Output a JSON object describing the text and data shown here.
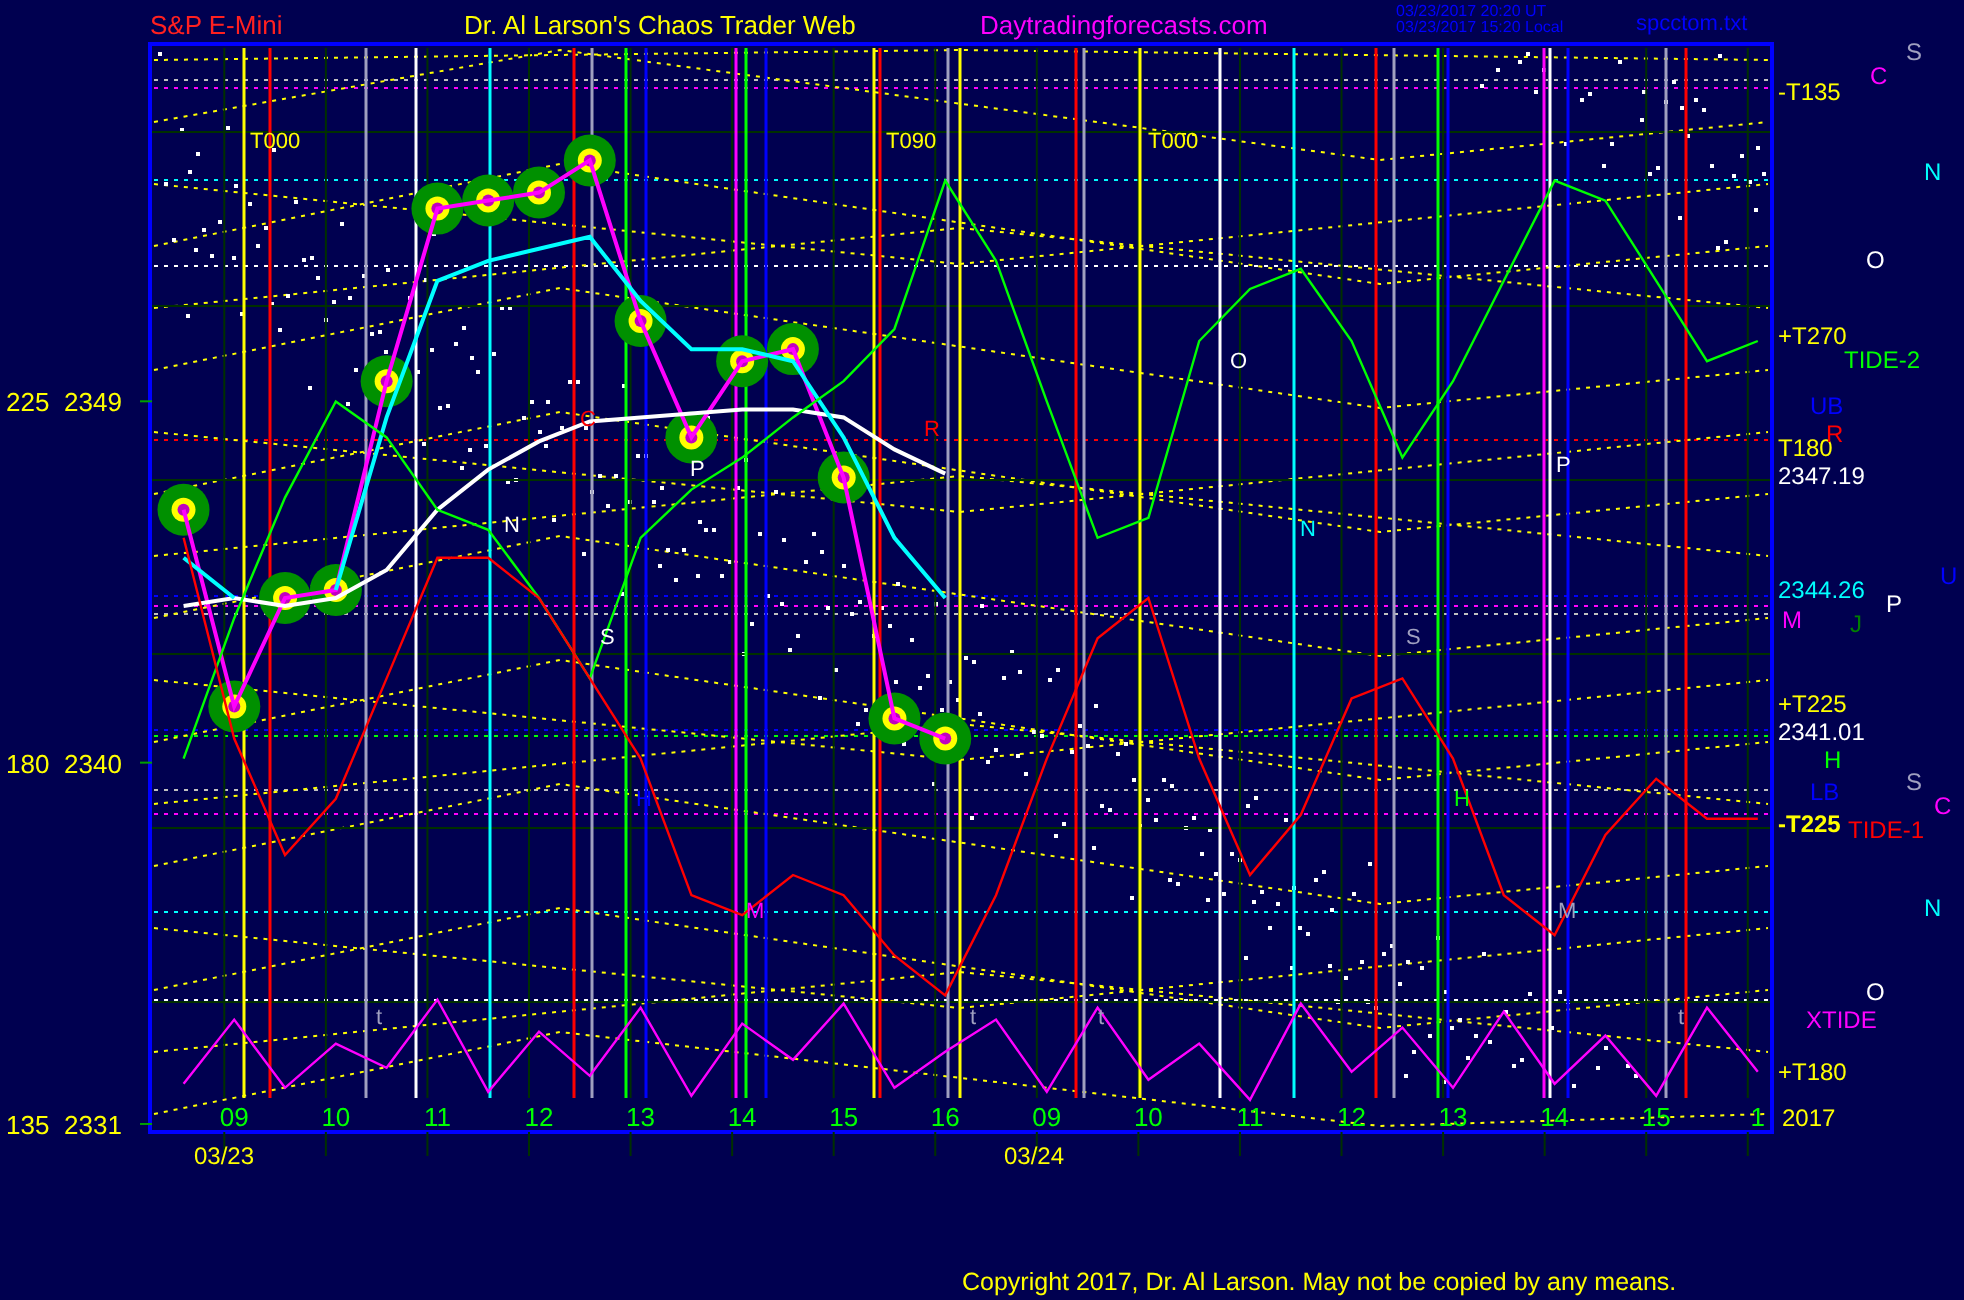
{
  "header": {
    "instrument": "S&P E-Mini",
    "title": "Dr. Al Larson's Chaos Trader Web",
    "site": "Daytradingforecasts.com",
    "timestamps": [
      "03/23/2017 20:20 UT",
      "03/23/2017 15:20 Local"
    ],
    "file": "spcctom.txt"
  },
  "angle_labels": [
    "225",
    "180",
    "135"
  ],
  "dates": [
    "03/23",
    "03/24"
  ],
  "chart": {
    "chart_data": {
      "type": "line",
      "categories": [
        null,
        "09",
        null,
        "10",
        null,
        "11",
        null,
        "12",
        null,
        "13",
        null,
        "14",
        null,
        "15",
        null,
        "16",
        null,
        "09",
        null,
        "10",
        null,
        "11",
        null,
        "12",
        null,
        "13",
        null,
        "14",
        null,
        "15",
        null,
        "1"
      ],
      "grid": true,
      "series": [
        {
          "color": "#ff00ff",
          "marker": "o",
          "values": [
            2346.3,
            2341.4,
            2344.1,
            2344.3,
            2349.5,
            2353.8,
            2354.0,
            2354.2,
            2355.0,
            2351.0,
            2348.1,
            2350.0,
            2350.3,
            2347.1,
            2341.1,
            2340.6,
            null,
            null,
            null,
            null,
            null,
            null,
            null,
            null,
            null,
            null,
            null,
            null,
            null,
            null,
            null,
            null
          ]
        },
        {
          "color": "#ffffff",
          "values": [
            2343.9,
            2344.1,
            2343.9,
            2344.1,
            2344.8,
            2346.3,
            2347.3,
            2348.0,
            2348.5,
            2348.6,
            2348.7,
            2348.8,
            2348.8,
            2348.6,
            2347.8,
            2347.2,
            null,
            null,
            null,
            null,
            null,
            null,
            null,
            null,
            null,
            null,
            null,
            null,
            null,
            null,
            null,
            null
          ]
        },
        {
          "color": "#00ffff",
          "values": [
            2345.1,
            2344.1,
            null,
            2344.3,
            2348.6,
            2352.0,
            2352.5,
            2352.8,
            2353.1,
            2351.5,
            2350.3,
            2350.3,
            2350.0,
            2348.1,
            2345.6,
            2344.1,
            null,
            null,
            null,
            null,
            null,
            null,
            null,
            null,
            null,
            null,
            null,
            null,
            null,
            null,
            null,
            null
          ]
        },
        {
          "name": "TIDE-2",
          "color": "#00ff00",
          "values": [
            2340.1,
            2343.6,
            2346.6,
            2349.0,
            2348.1,
            2346.3,
            2345.8,
            2344.1,
            2342.1,
            2345.6,
            2346.8,
            2347.6,
            2348.6,
            2349.5,
            2350.8,
            2354.5,
            2352.5,
            2349.0,
            2345.6,
            2346.1,
            2350.5,
            2351.8,
            2352.3,
            2350.5,
            2347.6,
            2349.5,
            2352.0,
            2354.5,
            2354.0,
            2352.0,
            2350.0,
            2350.5
          ]
        },
        {
          "name": "TIDE-1",
          "color": "#ff0000",
          "values": [
            2345.6,
            2340.6,
            2337.7,
            2339.1,
            2342.1,
            2345.1,
            2345.1,
            2344.1,
            2342.1,
            2340.1,
            2336.7,
            2336.2,
            2337.2,
            2336.7,
            2335.2,
            2334.2,
            2336.7,
            2340.1,
            2343.1,
            2344.1,
            2340.1,
            2337.2,
            2338.7,
            2341.6,
            2342.1,
            2340.1,
            2336.7,
            2335.7,
            2338.2,
            2339.6,
            2338.6,
            2338.6
          ]
        },
        {
          "name": "XTIDE",
          "color": "#ff00ff",
          "values": [
            2332.0,
            2333.6,
            2331.9,
            2333.0,
            2332.4,
            2334.1,
            2331.8,
            2333.3,
            2332.2,
            2333.9,
            2331.7,
            2333.5,
            2332.6,
            2334.0,
            2331.9,
            2332.8,
            2333.6,
            2331.8,
            2333.9,
            2332.1,
            2333.0,
            2331.6,
            2334.0,
            2332.3,
            2333.4,
            2331.9,
            2333.8,
            2332.0,
            2333.2,
            2331.7,
            2333.9,
            2332.3
          ]
        }
      ],
      "ylim": [
        2330.8,
        2357.9
      ],
      "yticks": [
        2331,
        2340,
        2349
      ]
    }
  },
  "top_labels": [
    "T000",
    "T090",
    "T000"
  ],
  "right_labels": [
    {
      "text": "-T135",
      "color": "#ffff00"
    },
    {
      "text": "+T270",
      "color": "#ffff00"
    },
    {
      "text": "T180",
      "color": "#ffff00"
    },
    {
      "text": "2347.19",
      "color": "#ffffff"
    },
    {
      "text": "2344.26",
      "color": "#00ffff"
    },
    {
      "text": "+T225",
      "color": "#ffff00"
    },
    {
      "text": "2341.01",
      "color": "#ffffff"
    },
    {
      "text": "-T225",
      "color": "#ffff00"
    },
    {
      "text": "+T180",
      "color": "#ffff00"
    },
    {
      "text": "2017",
      "color": "#ffff00"
    }
  ],
  "side_letters": [
    {
      "text": "S",
      "color": "#a0a0c0"
    },
    {
      "text": "C",
      "color": "#ff00ff"
    },
    {
      "text": "N",
      "color": "#00ffff"
    },
    {
      "text": "O",
      "color": "#ffffff"
    },
    {
      "text": "UB",
      "color": "#0000ff"
    },
    {
      "text": "R",
      "color": "#ff0000"
    },
    {
      "text": "U",
      "color": "#0000ff"
    },
    {
      "text": "M",
      "color": "#ff00ff"
    },
    {
      "text": "J",
      "color": "#008000"
    },
    {
      "text": "P",
      "color": "#ffffff"
    },
    {
      "text": "H",
      "color": "#00ff00"
    },
    {
      "text": "LB",
      "color": "#0000ff"
    },
    {
      "text": "S",
      "color": "#a0a0c0"
    },
    {
      "text": "C",
      "color": "#ff00ff"
    },
    {
      "text": "N",
      "color": "#00ffff"
    },
    {
      "text": "O",
      "color": "#ffffff"
    }
  ],
  "plot_letters": [
    {
      "text": "C",
      "color": "#ff0000"
    },
    {
      "text": "P",
      "color": "#ffffff"
    },
    {
      "text": "N",
      "color": "#ffffff"
    },
    {
      "text": "S",
      "color": "#ffffff"
    },
    {
      "text": "H",
      "color": "#0000ff"
    },
    {
      "text": "M",
      "color": "#ff00ff"
    },
    {
      "text": "R",
      "color": "#ff0000"
    },
    {
      "text": "O",
      "color": "#ffffff"
    },
    {
      "text": "N",
      "color": "#00ffff"
    },
    {
      "text": "S",
      "color": "#a0a0c0"
    },
    {
      "text": "P",
      "color": "#ffffff"
    },
    {
      "text": "H",
      "color": "#00ff00"
    },
    {
      "text": "M",
      "color": "#a0a0c0"
    },
    {
      "text": "t",
      "color": "#a0a0c0"
    },
    {
      "text": "t",
      "color": "#a0a0c0"
    },
    {
      "text": "t",
      "color": "#a0a0c0"
    },
    {
      "text": "t",
      "color": "#a0a0c0"
    }
  ],
  "copyright": "Copyright 2017, Dr. Al Larson. May not be copied by any means."
}
